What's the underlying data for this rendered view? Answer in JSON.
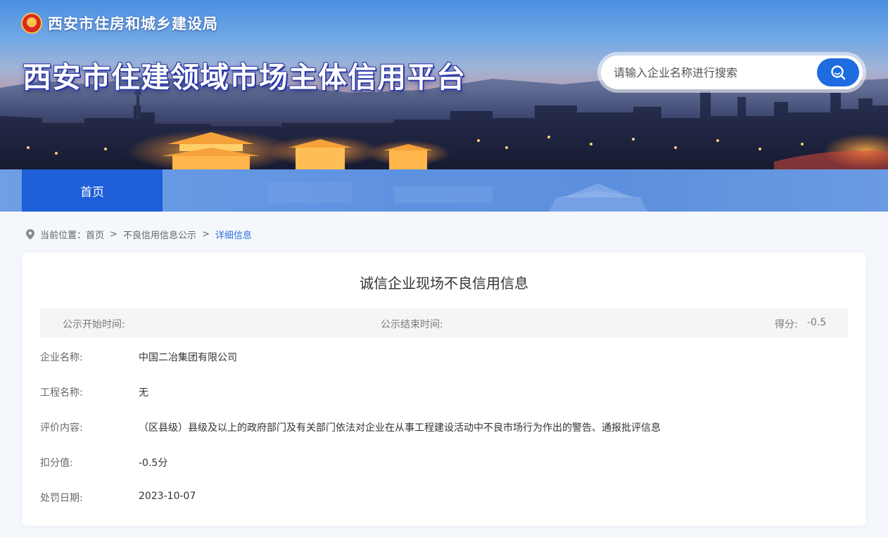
{
  "header": {
    "department": "西安市住房和城乡建设局",
    "platform_title": "西安市住建领域市场主体信用平台",
    "search_placeholder": "请输入企业名称进行搜索"
  },
  "nav": {
    "home": "首页"
  },
  "breadcrumb": {
    "prefix": "当前位置：",
    "items": [
      "首页",
      "不良信用信息公示",
      "详细信息"
    ],
    "separator": ">"
  },
  "record": {
    "title": "诚信企业现场不良信用信息",
    "meta": {
      "start_label": "公示开始时间:",
      "end_label": "公示结束时间:",
      "score_label": "得分:",
      "score_value": "-0.5"
    },
    "fields": [
      {
        "label": "企业名称:",
        "value": "中国二冶集团有限公司"
      },
      {
        "label": "工程名称:",
        "value": "无"
      },
      {
        "label": "评价内容:",
        "value": "（区县级）县级及以上的政府部门及有关部门依法对企业在从事工程建设活动中不良市场行为作出的警告、通报批评信息"
      },
      {
        "label": "扣分值:",
        "value": "-0.5分"
      },
      {
        "label": "处罚日期:",
        "value": "2023-10-07"
      }
    ]
  },
  "colors": {
    "primary_blue": "#1e5fd8",
    "nav_blue": "#5f93e2",
    "breadcrumb_active": "#2f6fde"
  }
}
